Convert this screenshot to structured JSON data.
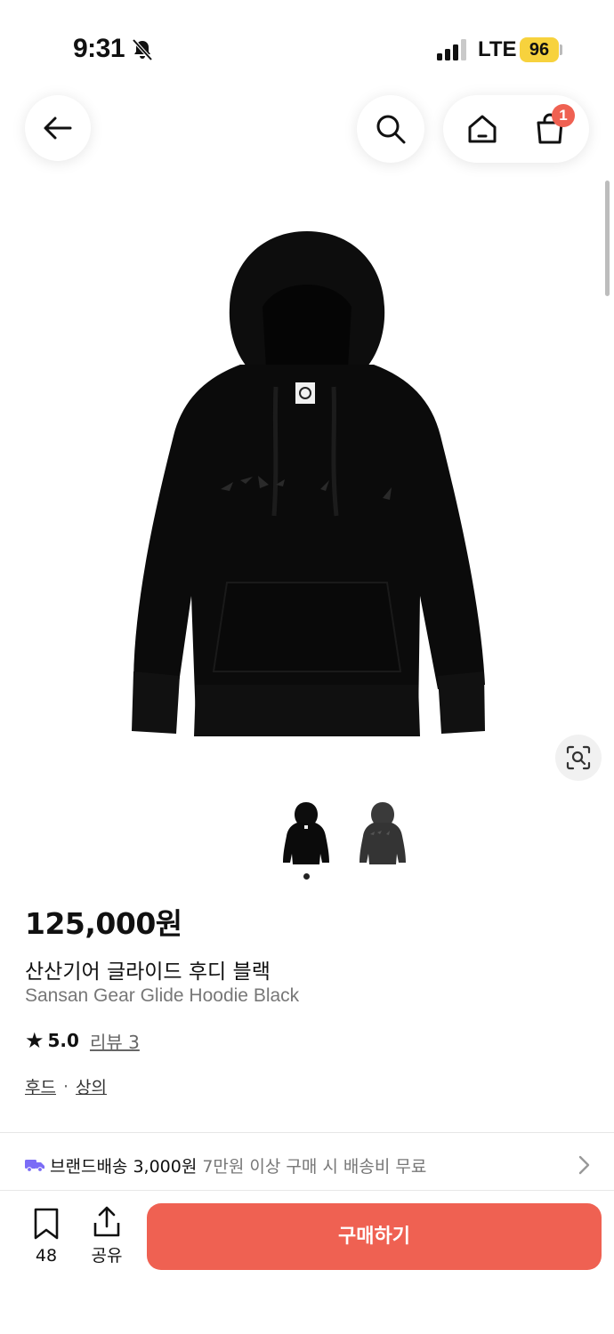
{
  "status_bar": {
    "time": "9:31",
    "network": "LTE",
    "battery": "96"
  },
  "nav": {
    "back_icon": "arrow-left-icon",
    "search_icon": "search-icon",
    "home_icon": "home-icon",
    "cart_icon": "shopping-bag-icon",
    "cart_badge": "1"
  },
  "gallery": {
    "thumbnails": [
      "hoodie-black-front",
      "hoodie-black-print"
    ],
    "current_index": 1,
    "lens_icon": "image-search-icon"
  },
  "product": {
    "price": "125,000원",
    "name_ko": "산산기어 글라이드 후디 블랙",
    "name_en": "Sansan Gear Glide Hoodie Black",
    "rating": "5.0",
    "review_label": "리뷰 3",
    "category_1": "후드",
    "category_separator": "·",
    "category_2": "상의"
  },
  "shipping": {
    "label": "브랜드배송 3,000원",
    "condition": "7만원 이상 구매 시 배송비 무료",
    "icon": "truck-icon"
  },
  "bottom_bar": {
    "bookmark_count": "48",
    "share_label": "공유",
    "buy_label": "구매하기",
    "accent_color": "#ef6152"
  }
}
